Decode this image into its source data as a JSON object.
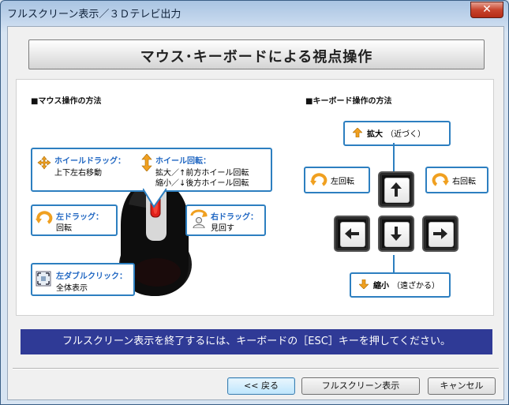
{
  "window": {
    "title": "フルスクリーン表示／３Ｄテレビ出力",
    "close_glyph": "✕"
  },
  "heading": "マウス･キーボードによる視点操作",
  "mouse_section": {
    "title": "■マウス操作の方法",
    "wheel_drag": {
      "label": "ホイールドラッグ：",
      "desc": "上下左右移動"
    },
    "wheel_rotate": {
      "label": "ホイール回転：",
      "line1": "拡大／↑前方ホイール回転",
      "line2": "縮小／↓後方ホイール回転"
    },
    "left_drag": {
      "label": "左ドラッグ：",
      "desc": "回転"
    },
    "right_drag": {
      "label": "右ドラッグ：",
      "desc": "見回す"
    },
    "left_double": {
      "label": "左ダブルクリック：",
      "desc": "全体表示"
    }
  },
  "keyboard_section": {
    "title": "■キーボード操作の方法",
    "zoom_in": {
      "label": "拡大",
      "note": "（近づく）"
    },
    "zoom_out": {
      "label": "縮小",
      "note": "（遠ざかる）"
    },
    "rotate_left": "左回転",
    "rotate_right": "右回転"
  },
  "banner": "フルスクリーン表示を終了するには、キーボードの［ESC］キーを押してください。",
  "buttons": {
    "back": "<< 戻る",
    "fullscreen": "フルスクリーン表示",
    "cancel": "キャンセル"
  },
  "colors": {
    "accent": "#2d7fc0",
    "banner": "#2f3a96",
    "arrow_orange": "#f0a020"
  }
}
